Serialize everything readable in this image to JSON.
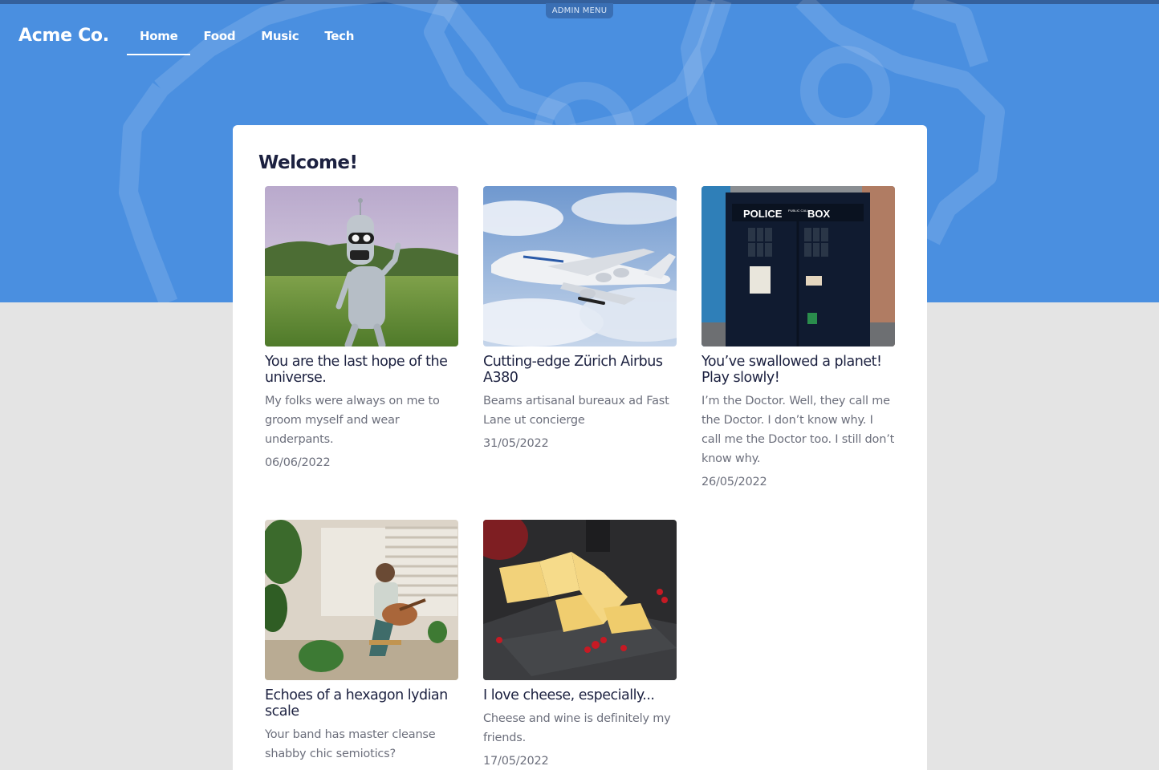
{
  "header": {
    "brand": "Acme Co.",
    "admin_menu": "ADMIN MENU",
    "nav": [
      {
        "label": "Home",
        "active": true
      },
      {
        "label": "Food",
        "active": false
      },
      {
        "label": "Music",
        "active": false
      },
      {
        "label": "Tech",
        "active": false
      }
    ]
  },
  "main": {
    "heading": "Welcome!",
    "cards": [
      {
        "title": "You are the last hope of the universe.",
        "excerpt": "My folks were always on me to groom myself and wear underpants.",
        "date": "06/06/2022",
        "image": "robot-in-park"
      },
      {
        "title": "Cutting-edge Zürich Airbus A380",
        "excerpt": "Beams artisanal bureaux ad Fast Lane ut concierge",
        "date": "31/05/2022",
        "image": "airbus-a380-in-sky"
      },
      {
        "title": "You’ve swallowed a planet! Play slowly!",
        "excerpt": "I’m the Doctor. Well, they call me the Doctor. I don’t know why. I call me the Doctor too. I still don’t know why.",
        "date": "26/05/2022",
        "image": "police-box",
        "sign": {
          "police": "POLICE",
          "public_call": "PUBLIC CALL",
          "box": "BOX"
        }
      },
      {
        "title": "Echoes of a hexagon lydian scale",
        "excerpt": "Your band has master cleanse shabby chic semiotics?",
        "date": "",
        "image": "woman-playing-guitar"
      },
      {
        "title": "I love cheese, especially...",
        "excerpt": "Cheese and wine is definitely my friends.",
        "date": "17/05/2022",
        "image": "cheese-on-slate"
      }
    ]
  },
  "colors": {
    "hero": "#4a8fe0",
    "background": "#e4e4e4",
    "panel": "#ffffff",
    "heading_text": "#1c2140",
    "muted_text": "#6c6f7c"
  }
}
